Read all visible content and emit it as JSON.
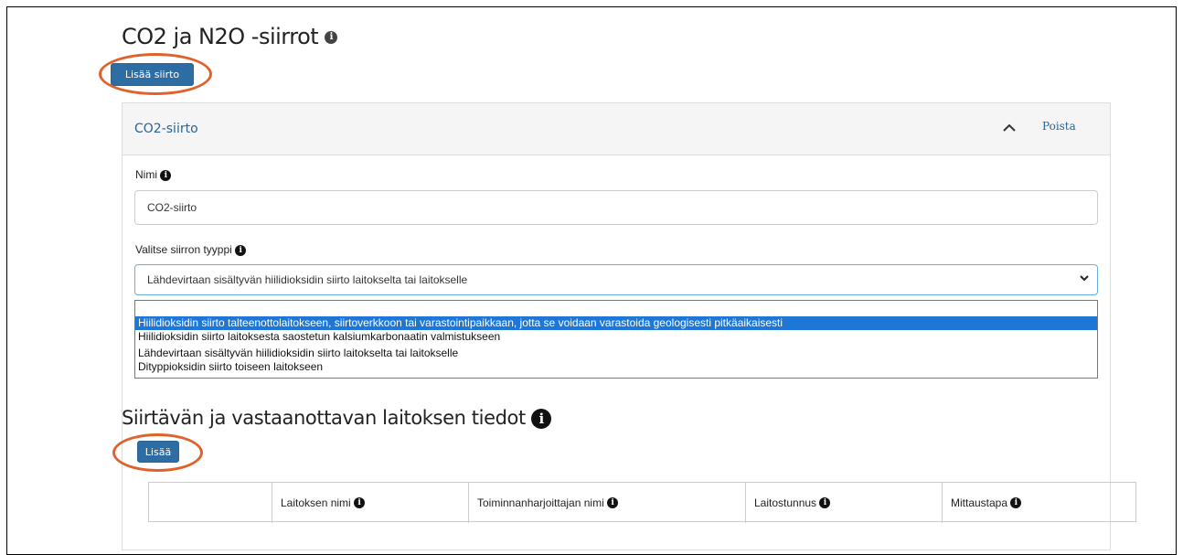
{
  "header": {
    "title": "CO2 ja N2O -siirrot",
    "info_icon": "info-icon"
  },
  "add_transfer_button": "Lisää siirto",
  "panel": {
    "title": "CO2-siirto",
    "collapse_icon": "chevron-up-icon",
    "delete_label": "Poista"
  },
  "name_field": {
    "label": "Nimi",
    "value": "CO2-siirto"
  },
  "transfer_type": {
    "label": "Valitse siirron tyyppi",
    "selected": "Lähdevirtaan sisältyvän hiilidioksidin siirto laitokselta tai laitokselle",
    "options": [
      "Hiilidioksidin siirto talteenottolaitokseen, siirtoverkkoon tai varastointipaikkaan, jotta se voidaan varastoida geologisesti pitkäaikaisesti",
      "Hiilidioksidin siirto laitoksesta saostetun kalsiumkarbonaatin valmistukseen",
      "Lähdevirtaan sisältyvän hiilidioksidin siirto laitokselta tai laitokselle",
      "Dityppioksidin siirto toiseen laitokseen"
    ],
    "highlighted_index": 0
  },
  "facilities_section": {
    "title": "Siirtävän ja vastaanottavan laitoksen tiedot",
    "add_button": "Lisää",
    "columns": [
      "",
      "Laitoksen nimi",
      "Toiminnanharjoittajan nimi",
      "Laitostunnus",
      "Mittaustapa"
    ]
  },
  "colors": {
    "accent": "#2e6da4",
    "highlight": "#1e76d6",
    "annotation": "#e0622a"
  }
}
